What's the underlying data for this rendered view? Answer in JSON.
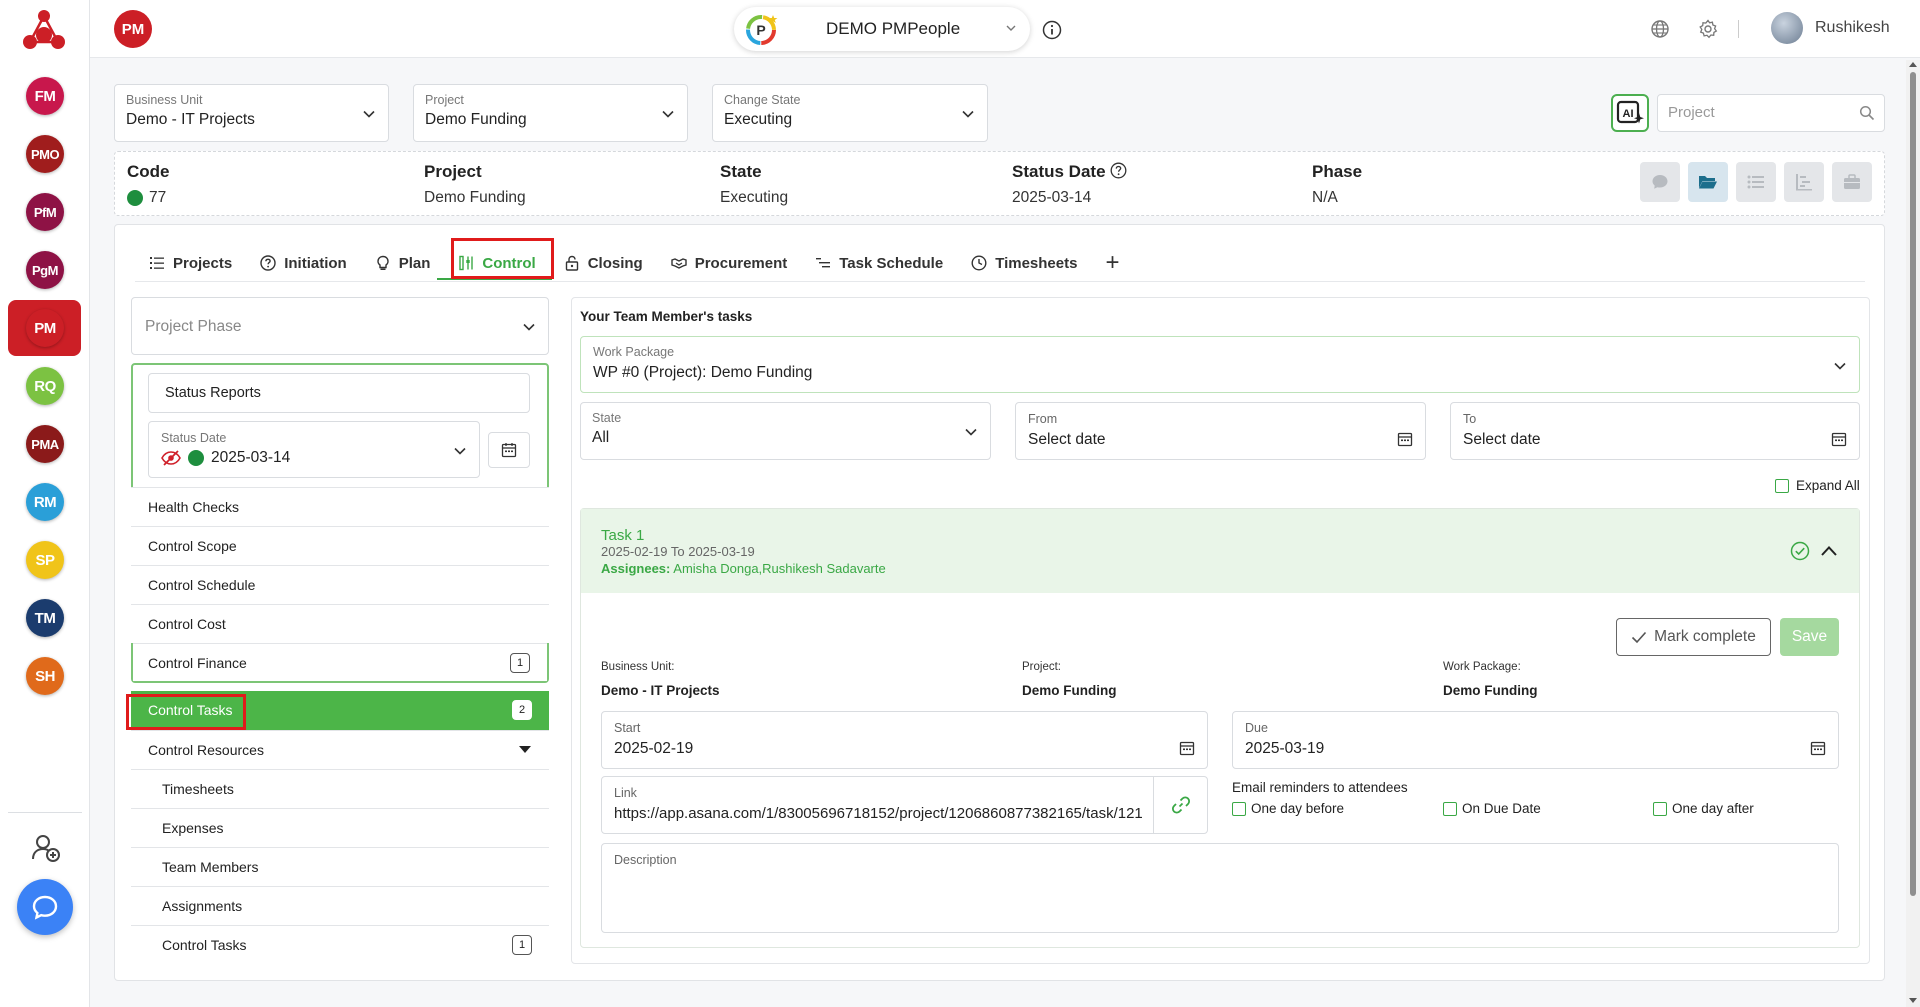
{
  "rail": {
    "items": [
      {
        "label": "FM",
        "color": "#c8174c"
      },
      {
        "label": "PMO",
        "color": "#a01d1d"
      },
      {
        "label": "PfM",
        "color": "#8e1245"
      },
      {
        "label": "PgM",
        "color": "#8e1245"
      },
      {
        "label": "PM",
        "color": "#cc1f26"
      },
      {
        "label": "RQ",
        "color": "#7cc242"
      },
      {
        "label": "PMA",
        "color": "#8b1a1a"
      },
      {
        "label": "RM",
        "color": "#2a9fd8"
      },
      {
        "label": "SP",
        "color": "#f0c419"
      },
      {
        "label": "TM",
        "color": "#1b3c6e"
      },
      {
        "label": "SH",
        "color": "#e06a1b"
      }
    ]
  },
  "topbar": {
    "module_badge": "PM",
    "org_name": "DEMO PMPeople",
    "user_name": "Rushikesh"
  },
  "filters": {
    "business_unit": {
      "label": "Business Unit",
      "value": "Demo - IT Projects"
    },
    "project": {
      "label": "Project",
      "value": "Demo Funding"
    },
    "change_state": {
      "label": "Change State",
      "value": "Executing"
    },
    "search_placeholder": "Project"
  },
  "summary": {
    "code": {
      "label": "Code",
      "value": "77"
    },
    "project": {
      "label": "Project",
      "value": "Demo Funding"
    },
    "state": {
      "label": "State",
      "value": "Executing"
    },
    "status_date": {
      "label": "Status Date",
      "value": "2025-03-14"
    },
    "phase": {
      "label": "Phase",
      "value": "N/A"
    }
  },
  "tabs": [
    {
      "label": "Projects",
      "icon": "list-icon"
    },
    {
      "label": "Initiation",
      "icon": "question-circle-icon"
    },
    {
      "label": "Plan",
      "icon": "plan-icon"
    },
    {
      "label": "Control",
      "icon": "control-icon",
      "active": true
    },
    {
      "label": "Closing",
      "icon": "lock-icon"
    },
    {
      "label": "Procurement",
      "icon": "handshake-icon"
    },
    {
      "label": "Task Schedule",
      "icon": "task-schedule-icon"
    },
    {
      "label": "Timesheets",
      "icon": "clock-icon"
    }
  ],
  "left_panel": {
    "phase_placeholder": "Project Phase",
    "status_reports": "Status Reports",
    "status_date_label": "Status Date",
    "status_date_value": "2025-03-14",
    "menu": [
      {
        "label": "Health Checks"
      },
      {
        "label": "Control Scope"
      },
      {
        "label": "Control Schedule"
      },
      {
        "label": "Control Cost"
      },
      {
        "label": "Control Finance",
        "count": "1"
      }
    ],
    "control_tasks": {
      "label": "Control Tasks",
      "count": "2"
    },
    "control_resources": "Control Resources",
    "resources": [
      {
        "label": "Timesheets"
      },
      {
        "label": "Expenses"
      },
      {
        "label": "Team Members"
      },
      {
        "label": "Assignments"
      },
      {
        "label": "Control Tasks",
        "count": "1"
      }
    ]
  },
  "right_panel": {
    "title": "Your Team Member's tasks",
    "work_package": {
      "label": "Work Package",
      "value": "WP #0 (Project): Demo Funding"
    },
    "state": {
      "label": "State",
      "value": "All"
    },
    "from": {
      "label": "From",
      "value": "Select date"
    },
    "to": {
      "label": "To",
      "value": "Select date"
    },
    "expand_all": "Expand All",
    "task": {
      "name": "Task 1",
      "dates": "2025-02-19 To 2025-03-19",
      "assignees_label": "Assignees:",
      "assignees": "Amisha Donga,Rushikesh Sadavarte",
      "mark_complete": "Mark complete",
      "save": "Save",
      "business_unit_label": "Business Unit:",
      "business_unit": "Demo - IT Projects",
      "project_label": "Project:",
      "project": "Demo Funding",
      "work_package_label": "Work Package:",
      "work_package": "Demo Funding",
      "start_label": "Start",
      "start": "2025-02-19",
      "due_label": "Due",
      "due": "2025-03-19",
      "link_label": "Link",
      "link": "https://app.asana.com/1/83005696718152/project/1206860877382165/task/121",
      "reminders_title": "Email reminders to attendees",
      "reminders": [
        "One day before",
        "On Due Date",
        "One day after"
      ],
      "description_label": "Description"
    }
  }
}
